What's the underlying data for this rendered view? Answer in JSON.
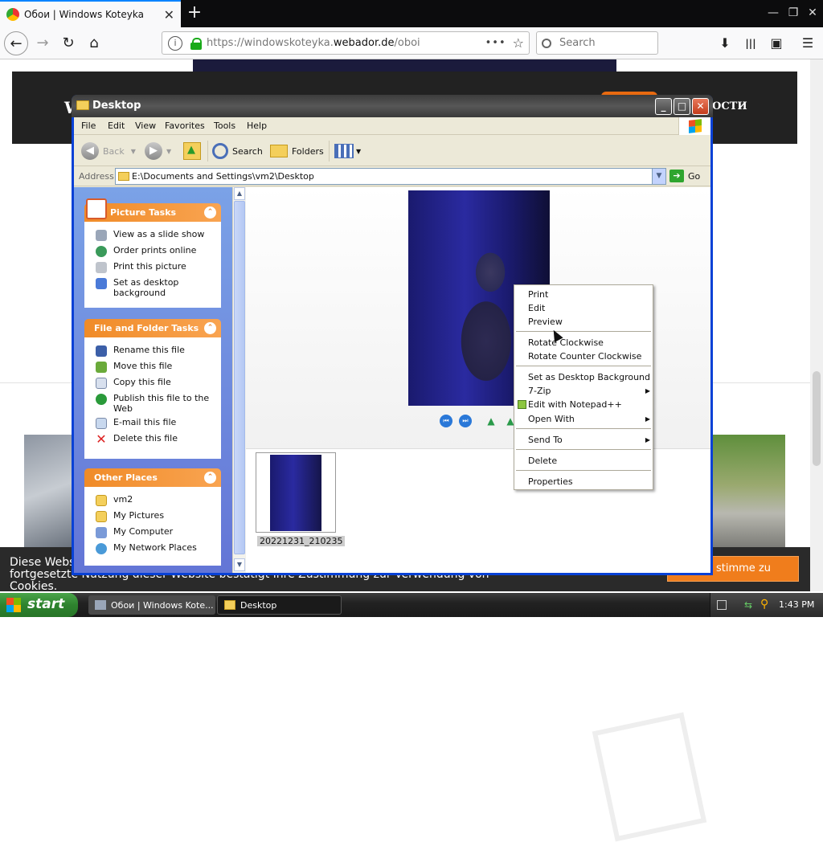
{
  "browser": {
    "tab_title": "Обои | Windows Koteyka",
    "tab_close": "✕",
    "new_tab": "+",
    "window_controls": {
      "minimize": "—",
      "restore": "❐",
      "close": "✕"
    },
    "nav": {
      "back": "←",
      "forward": "→",
      "reload": "↻",
      "home": "⌂"
    },
    "url_prefix": "https://windowskoteyka.",
    "url_domain": "webador.de",
    "url_path": "/oboi",
    "page_actions": "•••",
    "bookmark_star": "☆",
    "search_placeholder": "Search",
    "toolbar_icons": {
      "download": "⬇",
      "library": "|||",
      "sidebar": "▣",
      "menu": "☰"
    }
  },
  "website": {
    "header_initial": "W",
    "header_nav_fragment": "ОСТИ",
    "cookie_text_line1": "Diese Webs",
    "cookie_text_line2": "fortgesetzte Nutzung dieser Website bestätigt Ihre Zustimmung zur Verwendung von Cookies.",
    "cookie_button": "stimme zu"
  },
  "explorer": {
    "title": "Desktop",
    "controls": {
      "minimize": "_",
      "maximize": "□",
      "close": "✕"
    },
    "menu": [
      "File",
      "Edit",
      "View",
      "Favorites",
      "Tools",
      "Help"
    ],
    "toolbar": {
      "back": "Back",
      "search": "Search",
      "folders": "Folders"
    },
    "address_label": "Address",
    "address_value": "E:\\Documents and Settings\\vm2\\Desktop",
    "go_label": "Go",
    "picture_tasks": {
      "title": "Picture Tasks",
      "items": [
        "View as a slide show",
        "Order prints online",
        "Print this picture",
        "Set as desktop background"
      ]
    },
    "file_folder_tasks": {
      "title": "File and Folder Tasks",
      "items": [
        "Rename this file",
        "Move this file",
        "Copy this file",
        "Publish this file to the Web",
        "E-mail this file",
        "Delete this file"
      ]
    },
    "other_places": {
      "title": "Other Places",
      "items": [
        "vm2",
        "My Pictures",
        "My Computer",
        "My Network Places"
      ]
    },
    "thumbnail_label": "20221231_210235"
  },
  "context_menu": {
    "items": [
      "Print",
      "Edit",
      "Preview",
      "Rotate Clockwise",
      "Rotate Counter Clockwise",
      "Set as Desktop Background",
      "7-Zip",
      "Edit with Notepad++",
      "Open With",
      "Send To",
      "Delete",
      "Properties"
    ]
  },
  "taskbar": {
    "start": "start",
    "tasks": [
      "Обои | Windows Kote...",
      "Desktop"
    ],
    "clock": "1:43 PM"
  },
  "colors": {
    "xp_blue": "#0841d6",
    "task_header_orange": "#f08b28",
    "cookie_button": "#f07d1c"
  }
}
